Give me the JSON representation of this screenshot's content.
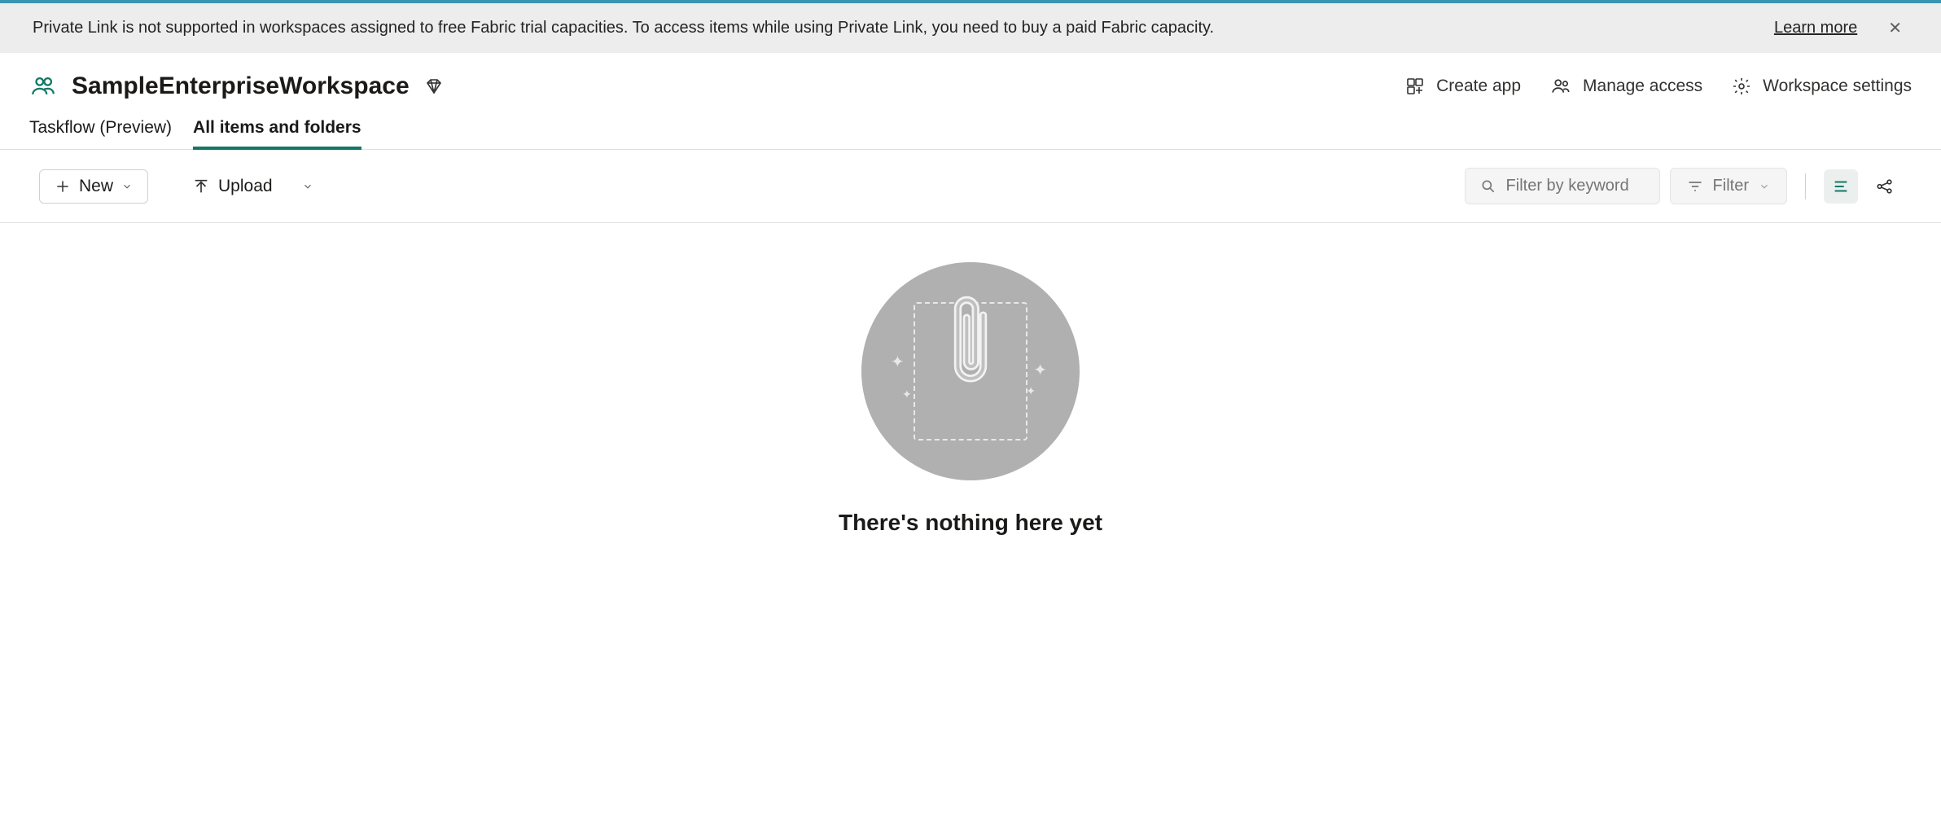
{
  "notification": {
    "message": "Private Link is not supported in workspaces assigned to free Fabric trial capacities. To access items while using Private Link, you need to buy a paid Fabric capacity.",
    "learn_more": "Learn more"
  },
  "workspace": {
    "title": "SampleEnterpriseWorkspace",
    "actions": {
      "create_app": "Create app",
      "manage_access": "Manage access",
      "settings": "Workspace settings"
    }
  },
  "tabs": {
    "taskflow": "Taskflow (Preview)",
    "all_items": "All items and folders"
  },
  "toolbar": {
    "new": "New",
    "upload": "Upload",
    "filter_placeholder": "Filter by keyword",
    "filter": "Filter"
  },
  "empty": {
    "title": "There's nothing here yet"
  },
  "colors": {
    "accent": "#117865",
    "top_bar": "#3a96b0"
  }
}
